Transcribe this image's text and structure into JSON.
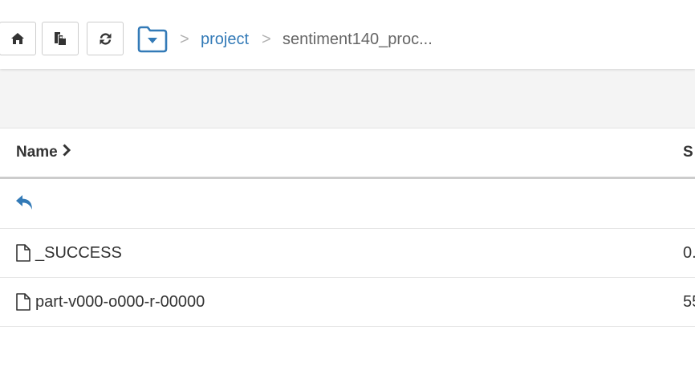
{
  "toolbar": {
    "home_icon": "home-icon",
    "copy_icon": "copy-icon",
    "refresh_icon": "refresh-icon"
  },
  "breadcrumb": {
    "folder_icon": "folder-dropdown-icon",
    "separator": ">",
    "items": [
      {
        "label": "project"
      },
      {
        "label": "sentiment140_proc..."
      }
    ]
  },
  "table": {
    "headers": {
      "name": "Name",
      "size": "S"
    },
    "back_icon": "reply-icon",
    "rows": [
      {
        "name": "_SUCCESS",
        "size": "0."
      },
      {
        "name": "part-v000-o000-r-00000",
        "size": "55"
      }
    ]
  },
  "colors": {
    "link": "#337ab7",
    "text": "#333333",
    "band": "#f4f4f4"
  }
}
